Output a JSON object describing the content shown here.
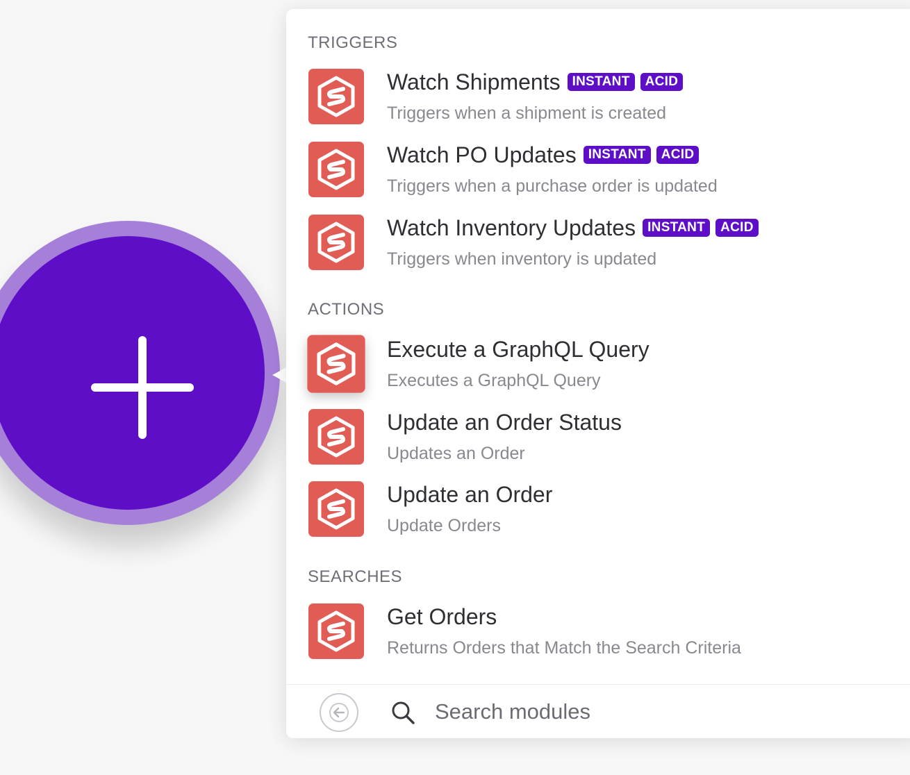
{
  "sections": {
    "triggers": "TRIGGERS",
    "actions": "ACTIONS",
    "searches": "SEARCHES"
  },
  "items": [
    {
      "title": "Watch Shipments",
      "desc": "Triggers when a shipment is created",
      "badges": [
        "INSTANT",
        "ACID"
      ]
    },
    {
      "title": "Watch PO Updates",
      "desc": "Triggers when a purchase order is updated",
      "badges": [
        "INSTANT",
        "ACID"
      ]
    },
    {
      "title": "Watch Inventory Updates",
      "desc": "Triggers when inventory is updated",
      "badges": [
        "INSTANT",
        "ACID"
      ]
    },
    {
      "title": "Execute a GraphQL Query",
      "desc": "Executes a GraphQL Query",
      "badges": []
    },
    {
      "title": "Update an Order Status",
      "desc": "Updates an Order",
      "badges": []
    },
    {
      "title": "Update an Order",
      "desc": "Update Orders",
      "badges": []
    },
    {
      "title": "Get Orders",
      "desc": "Returns Orders that Match the Search Criteria",
      "badges": []
    }
  ],
  "footer": {
    "search_placeholder": "Search modules"
  },
  "icons": {
    "add": "plus-icon",
    "app": "shippo-s-icon",
    "back": "back-arrow-icon",
    "search": "search-icon"
  },
  "colors": {
    "accent": "#5e0ec6",
    "ring": "#a67fd9",
    "app_icon": "#e25c56"
  }
}
